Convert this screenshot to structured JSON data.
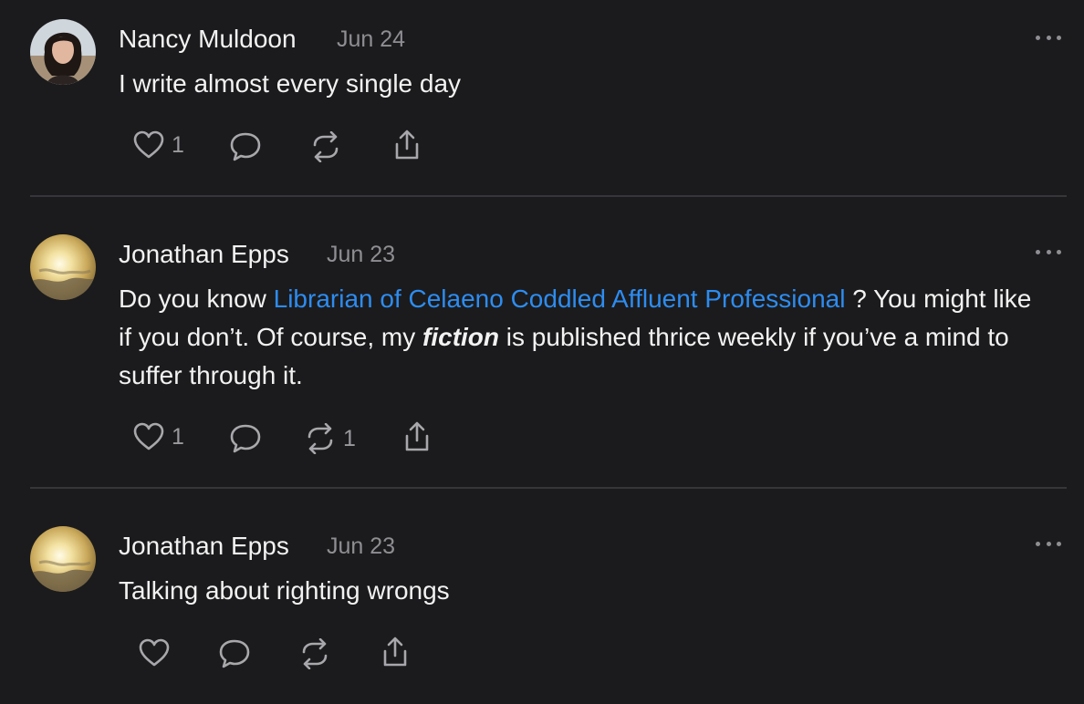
{
  "posts": [
    {
      "author": "Nancy Muldoon",
      "date": "Jun 24",
      "text": "I write almost every single day",
      "likes": "1",
      "restacks": ""
    },
    {
      "author": "Jonathan Epps",
      "date": "Jun 23",
      "text_before_link": "Do you know ",
      "link_text": "Librarian of Celaeno Coddled Affluent Professional",
      "text_after_link": " ? You might like if you don’t. Of course, my ",
      "emphasis": "fiction",
      "text_end": " is published thrice weekly if you’ve a mind to suffer through it.",
      "likes": "1",
      "restacks": "1"
    },
    {
      "author": "Jonathan Epps",
      "date": "Jun 23",
      "text": "Talking about righting wrongs",
      "likes": "",
      "restacks": ""
    }
  ],
  "icons": {
    "like": "heart-icon",
    "reply": "comment-bubble-icon",
    "restack": "restack-icon",
    "share": "share-icon",
    "more": "more-options-icon"
  },
  "colors": {
    "background": "#1b1b1d",
    "text": "#f2f2f2",
    "muted": "#8e8e93",
    "link": "#2d8cf0"
  }
}
